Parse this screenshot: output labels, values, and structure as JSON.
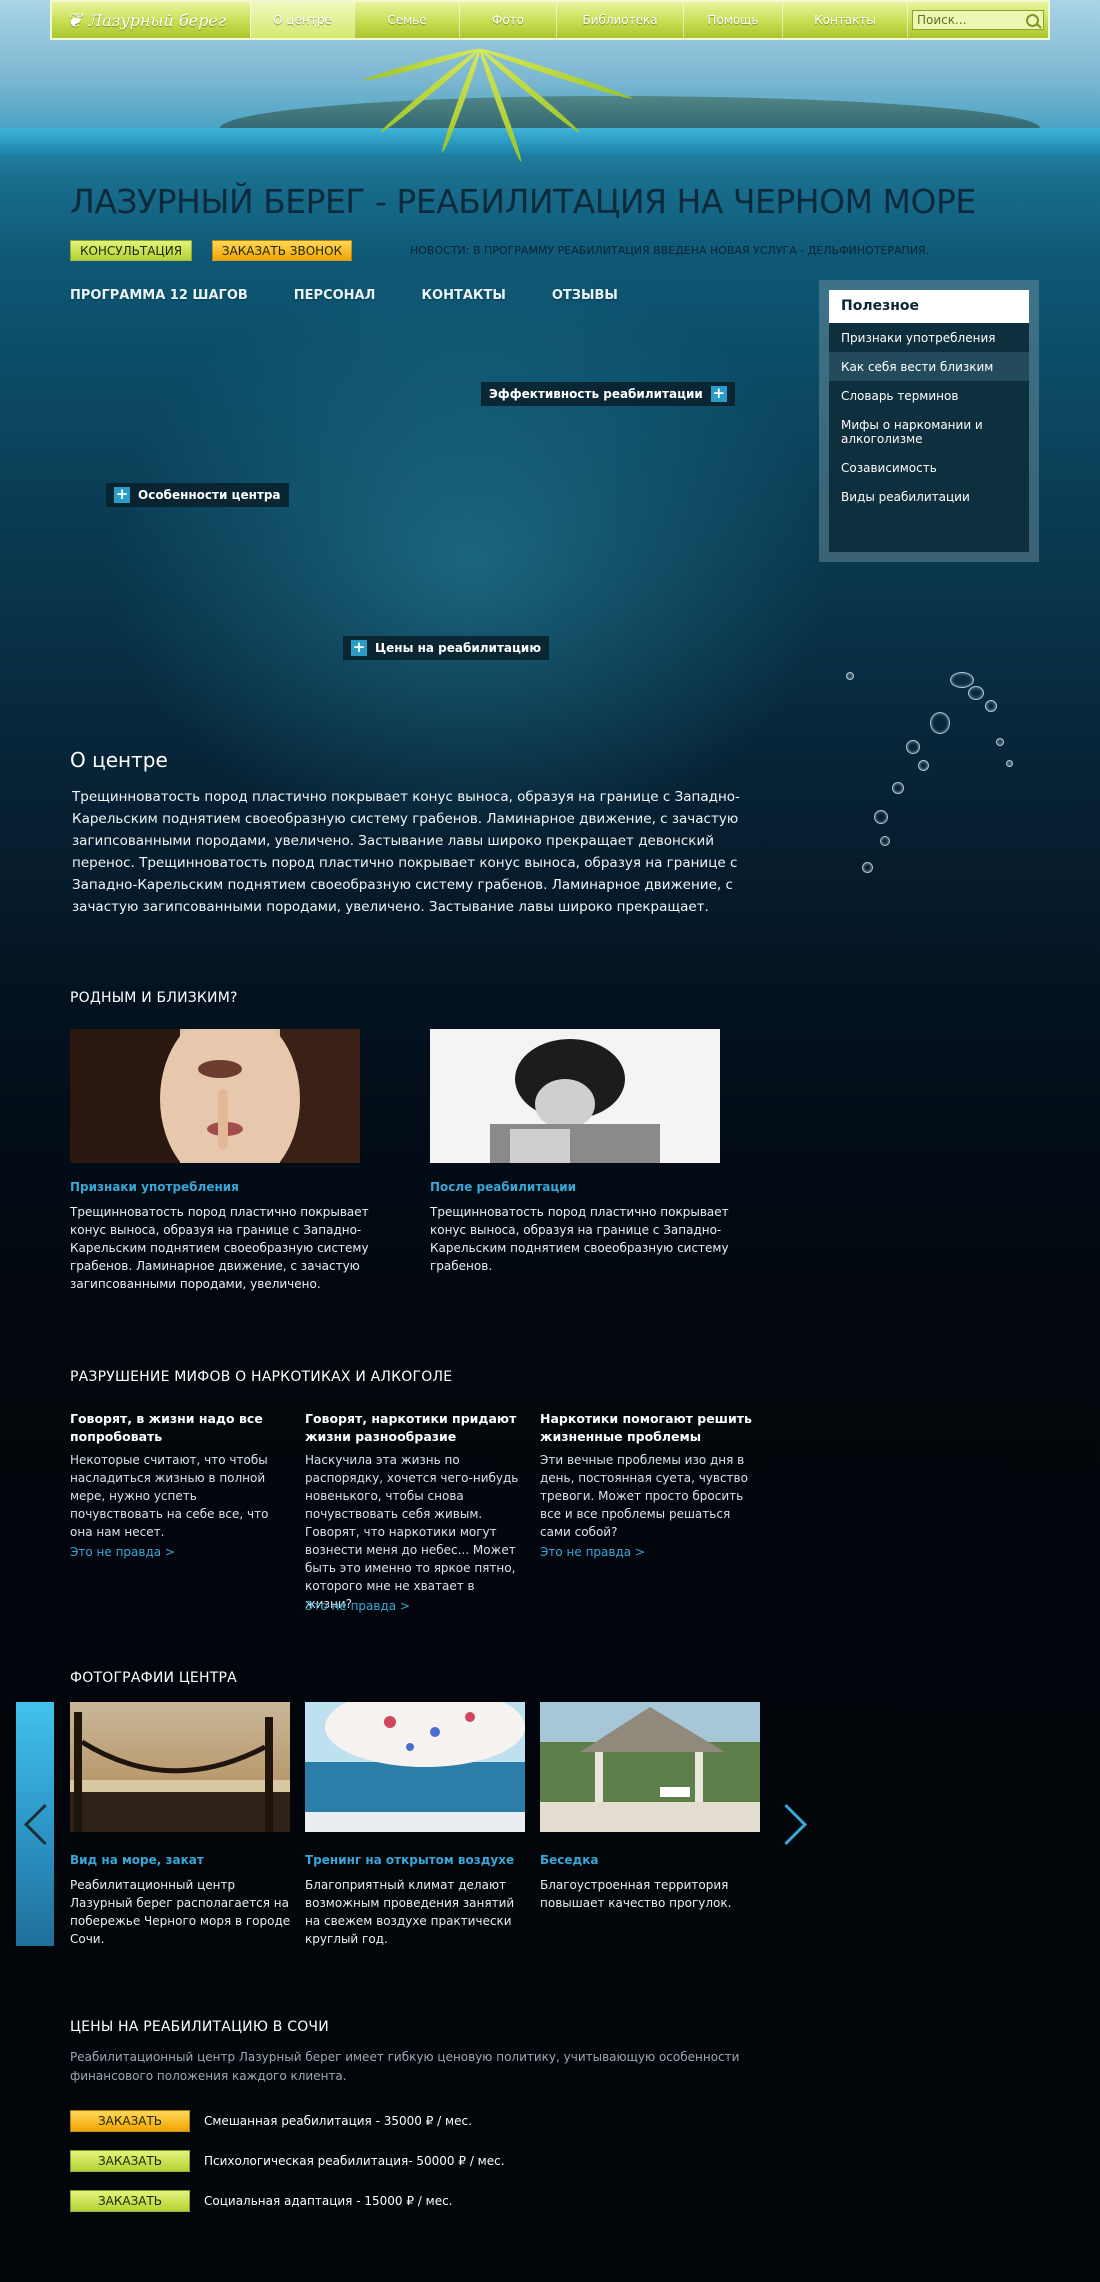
{
  "header": {
    "logo_text": "Лазурный берег",
    "nav": [
      "О центре",
      "Семье",
      "Фото",
      "Библиотека",
      "Помощь",
      "Контакты"
    ],
    "search_placeholder": "Поиск..."
  },
  "hero": {
    "title": "ЛАЗУРНЫЙ БЕРЕГ - РЕАБИЛИТАЦИЯ НА ЧЕРНОМ МОРЕ",
    "consult_label": "КОНСУЛЬТАЦИЯ",
    "call_label": "ЗАКАЗАТЬ ЗВОНОК",
    "news": "НОВОСТИ: В ПРОГРАММУ РЕАБИЛИТАЦИЯ ВВЕДЕНА НОВАЯ УСЛУГА - ДЕЛЬФИНОТЕРАПИЯ.",
    "subnav": [
      "ПРОГРАММА 12 ШАГОВ",
      "ПЕРСОНАЛ",
      "КОНТАКТЫ",
      "ОТЗЫВЫ"
    ],
    "hotspots": {
      "efficiency": "Эффективность реабилитации",
      "features": "Особенности центра",
      "prices": "Цены на реабилитацию"
    }
  },
  "sidebar": {
    "title": "Полезное",
    "items": [
      "Признаки употребления",
      "Как себя вести близким",
      "Словарь терминов",
      "Мифы о наркомании и алкоголизме",
      "Созависимость",
      "Виды реабилитации"
    ]
  },
  "about": {
    "title": "О центре",
    "text": "Трещинноватость пород пластично покрывает конус выноса, образуя на границе с Западно-Карельским поднятием своеобразную систему грабенов. Ламинарное движение, с зачастую загипсованными породами, увеличено. Застывание лавы широко прекращает девонский перенос. Трещинноватость пород пластично покрывает конус выноса, образуя на границе с Западно-Карельским поднятием своеобразную систему грабенов. Ламинарное движение, с зачастую загипсованными породами, увеличено. Застывание лавы широко прекращает."
  },
  "relatives": {
    "title": "РОДНЫМ И БЛИЗКИМ?",
    "cards": [
      {
        "title": "Признаки употребления",
        "text": "Трещинноватость пород пластично покрывает конус выноса, образуя на границе с Западно-Карельским поднятием своеобразную систему грабенов. Ламинарное движение, с зачастую загипсованными породами, увеличено."
      },
      {
        "title": "После реабилитации",
        "text": "Трещинноватость пород пластично покрывает конус выноса, образуя на границе с Западно-Карельским поднятием своеобразную систему грабенов."
      }
    ]
  },
  "myths": {
    "title": "РАЗРУШЕНИЕ МИФОВ О НАРКОТИКАХ И АЛКОГОЛЕ",
    "items": [
      {
        "heading": "Говорят, в жизни надо все попробовать",
        "text": "Некоторые считают, что чтобы насладиться жизнью в полной мере, нужно успеть почувствовать на себе все, что она нам несет.",
        "link": "Это не правда >"
      },
      {
        "heading": "Говорят, наркотики придают жизни разнообразие",
        "text": "Наскучила эта жизнь по распорядку, хочется чего-нибудь новенького, чтобы снова почувствовать себя живым. Говорят, что наркотики могут вознести меня до небес... Может быть это именно то яркое пятно, которого мне не хватает в жизни?",
        "link": "Это не правда >"
      },
      {
        "heading": "Наркотики помогают решить жизненные проблемы",
        "text": "Эти вечные проблемы изо дня в день, постоянная суета, чувство тревоги. Может просто бросить все и все проблемы решаться сами собой?",
        "link": "Это не правда >"
      }
    ]
  },
  "gallery": {
    "title": "ФОТОГРАФИИ ЦЕНТРА",
    "items": [
      {
        "title": "Вид на море, закат",
        "text": "Реабилитационный центр Лазурный берег располагается на побережье Черного моря в городе Сочи."
      },
      {
        "title": "Тренинг на открытом воздухе",
        "text": "Благоприятный климат делают возможным проведения занятий на свежем воздухе практически круглый год."
      },
      {
        "title": "Беседка",
        "text": "Благоустроенная территория повышает качество прогулок."
      }
    ]
  },
  "prices": {
    "title": "ЦЕНЫ НА РЕАБИЛИТАЦИЮ В СОЧИ",
    "intro": "Реабилитационный центр Лазурный берег имеет гибкую ценовую политику, учитывающую особенности финансового положения каждого клиента.",
    "order_label": "ЗАКАЗАТЬ",
    "items": [
      "Смешанная реабилитация - 35000 ₽ / мес.",
      "Психологическая реабилитация- 50000 ₽ / мес.",
      "Социальная адаптация - 15000 ₽ / мес."
    ]
  },
  "colors": {
    "accent_green": "#b4d234",
    "accent_orange": "#f3a400",
    "link_blue": "#3aa6d6"
  }
}
